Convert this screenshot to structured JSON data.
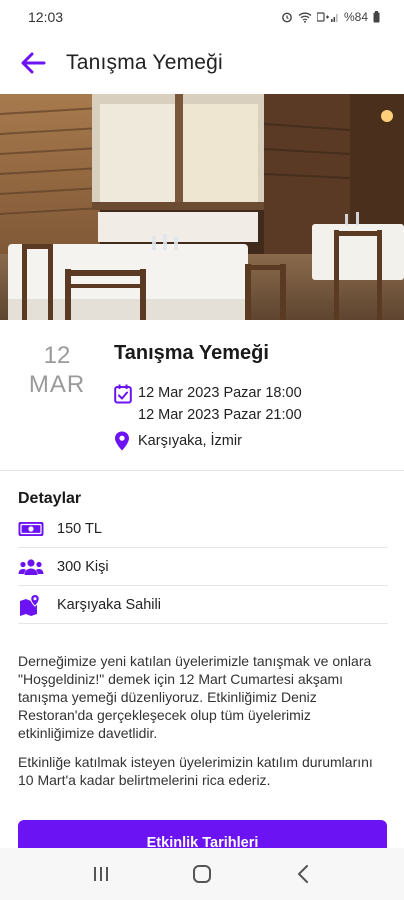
{
  "status_bar": {
    "time": "12:03",
    "battery": "%84"
  },
  "app_bar": {
    "title": "Tanışma Yemeği"
  },
  "event": {
    "day": "12",
    "month": "MAR",
    "title": "Tanışma Yemeği",
    "start": "12 Mar 2023 Pazar 18:00",
    "end": "12 Mar 2023 Pazar 21:00",
    "location": "Karşıyaka, İzmir"
  },
  "details": {
    "title": "Detaylar",
    "items": [
      {
        "icon": "money-icon",
        "text": "150 TL"
      },
      {
        "icon": "people-icon",
        "text": "300 Kişi"
      },
      {
        "icon": "map-icon",
        "text": "Karşıyaka Sahili"
      }
    ]
  },
  "description": {
    "p1": "Derneğimize yeni katılan üyelerimizle tanışmak ve onlara \"Hoşgeldiniz!\" demek için 12 Mart Cumartesi akşamı tanışma yemeği düzenliyoruz. Etkinliğimiz Deniz Restoran'da gerçekleşecek olup tüm üyelerimiz etkinliğimize davetlidir.",
    "p2": "Etkinliğe katılmak isteyen üyelerimizin katılım durumlarını 10 Mart'a kadar belirtmelerini rica ederiz."
  },
  "cta": {
    "label": "Etkinlik Tarihleri"
  },
  "colors": {
    "accent": "#6b13f2",
    "muted": "#9a9a9a"
  },
  "nav": {
    "recents": "recents-icon",
    "home": "home-icon",
    "back": "nav-back-icon"
  }
}
